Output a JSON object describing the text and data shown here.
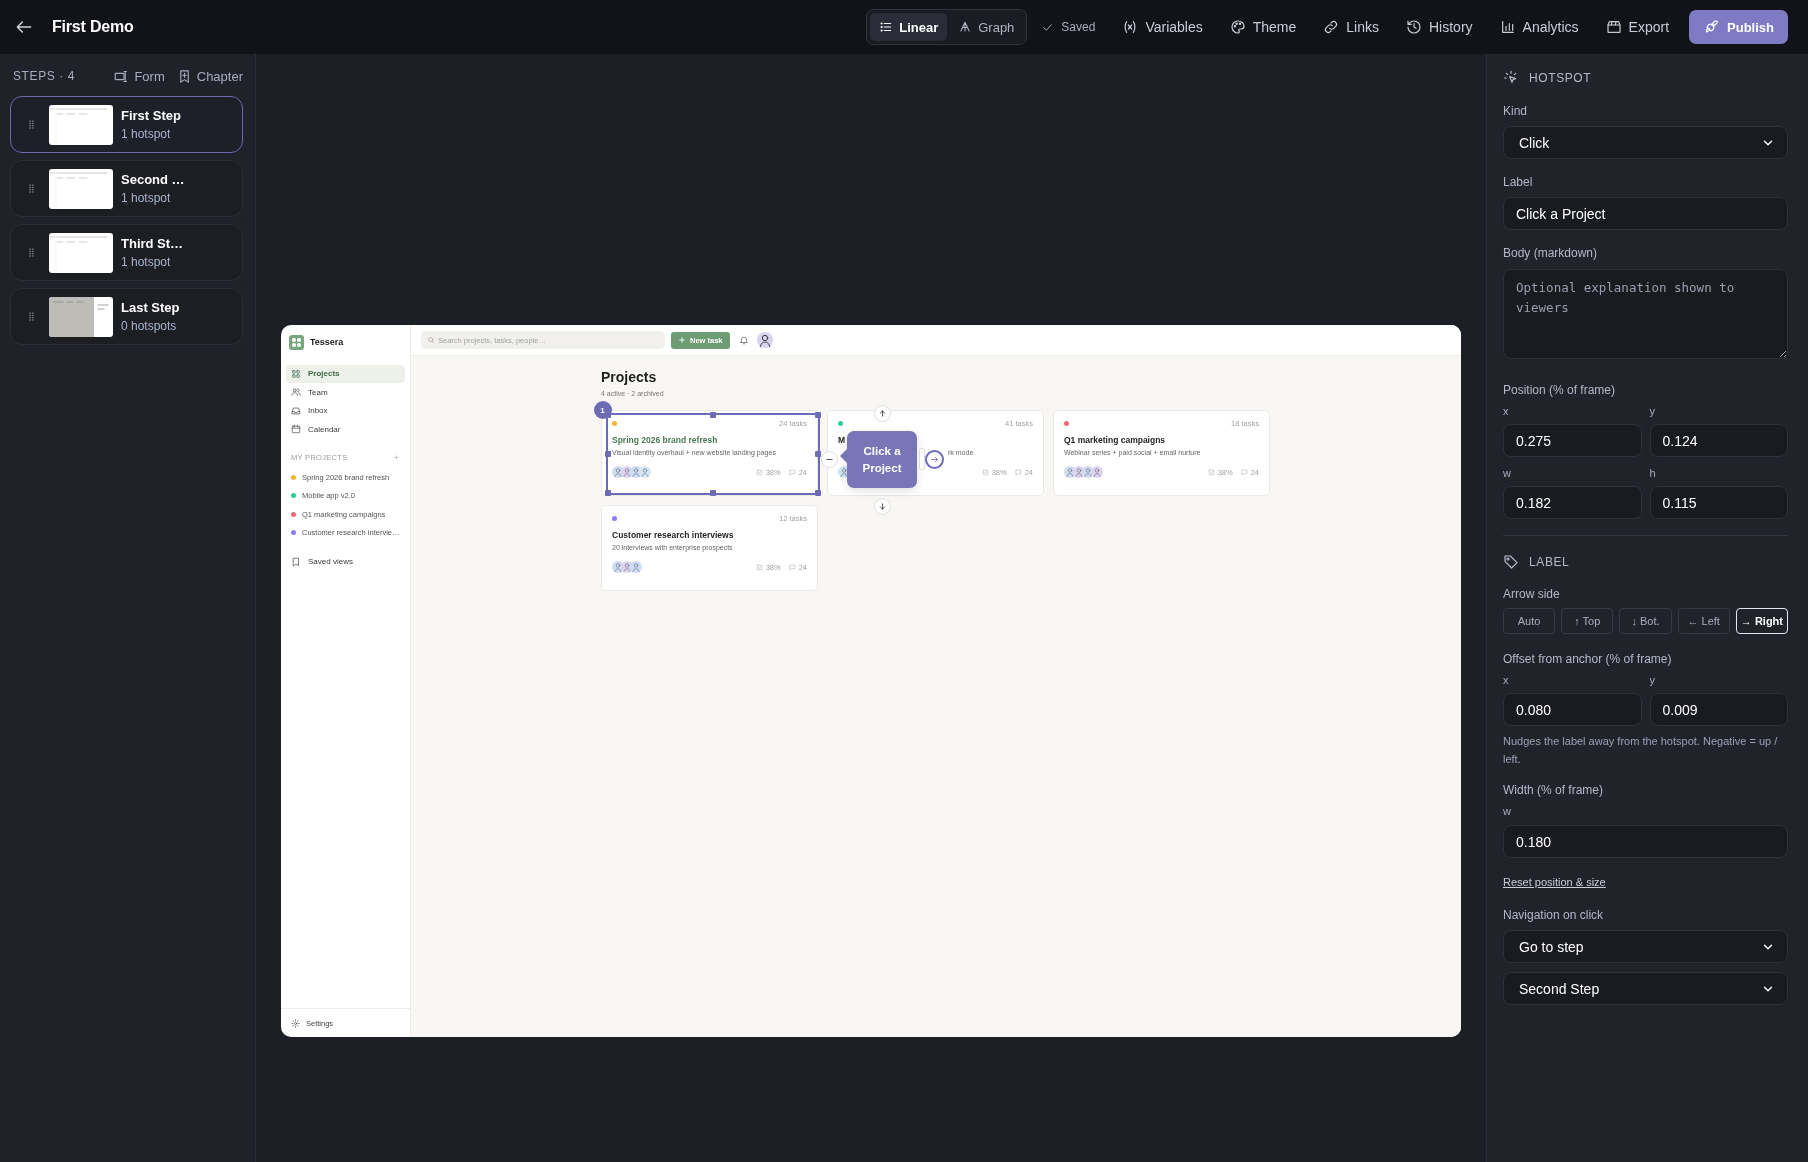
{
  "app_bar": {
    "title": "First Demo",
    "view_modes": [
      {
        "label": "Linear",
        "selected": true
      },
      {
        "label": "Graph",
        "selected": false
      }
    ],
    "save_status": "Saved",
    "actions": [
      "Variables",
      "Theme",
      "Links",
      "History",
      "Analytics",
      "Export"
    ],
    "publish": "Publish"
  },
  "steps_panel": {
    "heading": "STEPS · 4",
    "actions": [
      "Form",
      "Chapter"
    ],
    "steps": [
      {
        "title": "First Step",
        "subtitle": "1 hotspot",
        "selected": true,
        "kind": "page"
      },
      {
        "title": "Second …",
        "subtitle": "1 hotspot",
        "selected": false,
        "kind": "page"
      },
      {
        "title": "Third St…",
        "subtitle": "1 hotspot",
        "selected": false,
        "kind": "page"
      },
      {
        "title": "Last Step",
        "subtitle": "0 hotspots",
        "selected": false,
        "kind": "dimmed"
      }
    ]
  },
  "preview": {
    "brand": "Tessera",
    "nav": [
      {
        "label": "Projects",
        "selected": true
      },
      {
        "label": "Team",
        "selected": false
      },
      {
        "label": "Inbox",
        "selected": false
      },
      {
        "label": "Calendar",
        "selected": false
      }
    ],
    "section_heading": "MY PROJECTS",
    "add": "+",
    "projects": [
      {
        "label": "Spring 2026 brand refresh",
        "color": "#f2b632"
      },
      {
        "label": "Mobile app v2.0",
        "color": "#2fcf93"
      },
      {
        "label": "Q1 marketing campaigns",
        "color": "#f06a7e"
      },
      {
        "label": "Customer research intervie…",
        "color": "#8a7cf2"
      }
    ],
    "saved_views": "Saved views",
    "settings": "Settings",
    "search_placeholder": "Search projects, tasks, people…",
    "new_task": "New task",
    "page_title": "Projects",
    "page_subtitle": "4 active · 2 archived",
    "cards": [
      {
        "kind": "full",
        "title": "Spring 2026 brand refresh",
        "description": "Visual identity overhaul + new website landing pages",
        "tasks": "24 tasks",
        "progress": "38%",
        "comments": "24",
        "color": "#f2b632",
        "highlighted": true,
        "avatars": [
          {
            "color": "#cfdcf5"
          },
          {
            "color": "#ddd3f3"
          },
          {
            "color": "#cfdcf5"
          },
          {
            "color": "#d7e6f7"
          }
        ]
      },
      {
        "kind": "covered",
        "title": "M",
        "description": "rk mode",
        "tasks": "41 tasks",
        "progress": "38%",
        "comments": "24",
        "color": "#2fcf93",
        "highlighted": false,
        "avatars": [
          {
            "color": "#cfe3f3"
          }
        ]
      },
      {
        "kind": "full",
        "title": "Q1 marketing campaigns",
        "description": "Webinar series + paid social + email nurture",
        "tasks": "18 tasks",
        "progress": "38%",
        "comments": "24",
        "color": "#f06a7e",
        "highlighted": false,
        "avatars": [
          {
            "color": "#cfdcf5"
          },
          {
            "color": "#ddd3f3"
          },
          {
            "color": "#cfdcf5"
          },
          {
            "color": "#ddd3f3"
          }
        ]
      },
      {
        "kind": "full",
        "title": "Customer research interviews",
        "description": "20 interviews with enterprise prospects",
        "tasks": "12 tasks",
        "progress": "38%",
        "comments": "24",
        "color": "#8a7cf2",
        "highlighted": false,
        "avatars": [
          {
            "color": "#cfdcf5"
          },
          {
            "color": "#ddd3f3"
          },
          {
            "color": "#cfdcf5"
          }
        ]
      }
    ],
    "hotspot": {
      "number": "1",
      "label": "Click a Project"
    }
  },
  "inspector": {
    "hotspot_heading": "HOTSPOT",
    "kind": {
      "label": "Kind",
      "value": "Click"
    },
    "label": {
      "label": "Label",
      "value": "Click a Project"
    },
    "body": {
      "label": "Body (markdown)",
      "placeholder": "Optional explanation shown to viewers"
    },
    "position": {
      "label": "Position (% of frame)",
      "fields": [
        {
          "name": "x",
          "value": "0.275"
        },
        {
          "name": "y",
          "value": "0.124"
        },
        {
          "name": "w",
          "value": "0.182"
        },
        {
          "name": "h",
          "value": "0.115"
        }
      ]
    },
    "label_heading": "LABEL",
    "arrow_side": {
      "label": "Arrow side",
      "options": [
        {
          "label": "Auto",
          "selected": false
        },
        {
          "label": "↑ Top",
          "selected": false
        },
        {
          "label": "↓ Bot.",
          "selected": false
        },
        {
          "label": "← Left",
          "selected": false
        },
        {
          "label": "→ Right",
          "selected": true
        }
      ]
    },
    "offset": {
      "label": "Offset from anchor (% of frame)",
      "fields": [
        {
          "name": "x",
          "value": "0.080"
        },
        {
          "name": "y",
          "value": "0.009"
        }
      ],
      "hint": "Nudges the label away from the hotspot. Negative = up / left."
    },
    "width": {
      "label": "Width (% of frame)",
      "fields": [
        {
          "name": "w",
          "value": "0.180"
        }
      ]
    },
    "reset_link": "Reset position & size",
    "navigation": {
      "label": "Navigation on click",
      "action": "Go to step",
      "target": "Second Step"
    }
  }
}
